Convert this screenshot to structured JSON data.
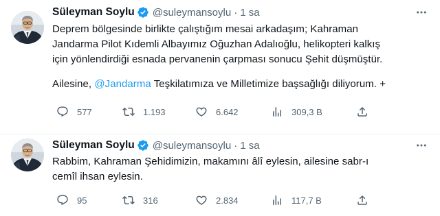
{
  "tweets": [
    {
      "author_name": "Süleyman Soylu",
      "handle": "@suleymansoylu",
      "separator": "·",
      "time": "1 sa",
      "lines": [
        "Deprem bölgesinde birlikte çalıştığım mesai arkadaşım; Kahraman",
        "Jandarma Pilot Kıdemli Albayımız Oğuzhan Adalıoğlu, helikopteri kalkış",
        "için yönlendirdiği esnada pervanenin çarpması sonucu Şehit düşmüştür."
      ],
      "line4_before": "Ailesine, ",
      "mention": "@Jandarma",
      "line4_after": " Teşkilatımıza ve Milletimize başsağlığı diliyorum. +",
      "replies": "577",
      "retweets": "1.193",
      "likes": "6.642",
      "views": "309,3 B"
    },
    {
      "author_name": "Süleyman Soylu",
      "handle": "@suleymansoylu",
      "separator": "·",
      "time": "1 sa",
      "lines": [
        "Rabbim, Kahraman Şehidimizin, makamını âlî eylesin, ailesine sabr-ı",
        "cemîl ihsan eylesin."
      ],
      "replies": "95",
      "retweets": "316",
      "likes": "2.834",
      "views": "117,7 B"
    }
  ],
  "colors": {
    "text": "#0f1419",
    "secondary": "#536471",
    "link": "#1d9bf0",
    "verified": "#1d9bf0",
    "divider": "#eff3f4"
  },
  "icons": [
    "more-icon",
    "verified-badge-icon",
    "reply-icon",
    "retweet-icon",
    "like-icon",
    "views-icon",
    "share-icon"
  ]
}
